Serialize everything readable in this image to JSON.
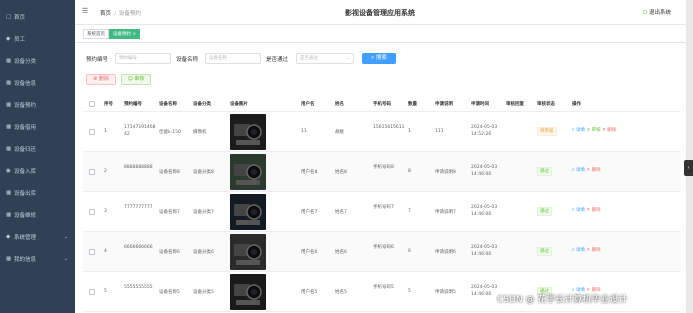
{
  "app": {
    "title": "影视设备管理应用系统",
    "logout": "退出系统"
  },
  "breadcrumb": {
    "home": "首页",
    "sep": "/",
    "current": "设备预约"
  },
  "sidebar": {
    "items": [
      {
        "label": "首页",
        "icon": "□"
      },
      {
        "label": "员工",
        "icon": "◆"
      },
      {
        "label": "设备分类",
        "icon": "▦"
      },
      {
        "label": "设备信息",
        "icon": "▦"
      },
      {
        "label": "设备预约",
        "icon": "▦"
      },
      {
        "label": "设备借用",
        "icon": "▦"
      },
      {
        "label": "设备归还",
        "icon": "▦"
      },
      {
        "label": "设备入库",
        "icon": "◉"
      },
      {
        "label": "设备出库",
        "icon": "▦"
      },
      {
        "label": "设备维修",
        "icon": "▦"
      },
      {
        "label": "系统管理",
        "icon": "◆",
        "arrow": "⌄"
      },
      {
        "label": "我的信息",
        "icon": "▦",
        "arrow": "⌄"
      }
    ]
  },
  "tabs": [
    {
      "label": "系统首页"
    },
    {
      "label": "设备预约 ×"
    }
  ],
  "search": {
    "f1_label": "预约编号",
    "f1_ph": "预约编号",
    "f2_label": "设备名称",
    "f2_ph": "设备名称",
    "f3_label": "是否通过",
    "f3_ph": "是否通过",
    "btn": "搜索"
  },
  "actions": {
    "delete": "删除",
    "audit": "审核"
  },
  "columns": [
    "序号",
    "预约编号",
    "设备名称",
    "设备分类",
    "设备图片",
    "用户名",
    "姓名",
    "手机号码",
    "数量",
    "申请说明",
    "申请时间",
    "审核回复",
    "审核状态",
    "操作"
  ],
  "rows": [
    {
      "no": "1",
      "code": "17147191468 42",
      "name": "佳能k-150",
      "cat": "摄像机",
      "user": "11",
      "realname": "胡桃",
      "phone": "15615615611",
      "qty": "1",
      "desc": "111",
      "time": "2024-05-03 14:52:26",
      "reply": "",
      "status": "待审核",
      "st": "p"
    },
    {
      "no": "2",
      "code": "8888888888",
      "name": "设备名称8",
      "cat": "设备分类8",
      "user": "用户名8",
      "realname": "姓名8",
      "phone": "手机号码8",
      "qty": "8",
      "desc": "申请说明8",
      "time": "2024-05-03 14:46:00",
      "reply": "",
      "status": "通过",
      "st": "g"
    },
    {
      "no": "3",
      "code": "7777777777",
      "name": "设备名称7",
      "cat": "设备分类7",
      "user": "用户名7",
      "realname": "姓名7",
      "phone": "手机号码7",
      "qty": "7",
      "desc": "申请说明7",
      "time": "2024-05-03 14:46:00",
      "reply": "",
      "status": "通过",
      "st": "g"
    },
    {
      "no": "4",
      "code": "6666666666",
      "name": "设备名称6",
      "cat": "设备分类6",
      "user": "用户名6",
      "realname": "姓名6",
      "phone": "手机号码6",
      "qty": "6",
      "desc": "申请说明6",
      "time": "2024-05-03 14:46:00",
      "reply": "",
      "status": "通过",
      "st": "g"
    },
    {
      "no": "5",
      "code": "5555555555",
      "name": "设备名称5",
      "cat": "设备分类5",
      "user": "用户名5",
      "realname": "姓名5",
      "phone": "手机号码5",
      "qty": "5",
      "desc": "申请说明5",
      "time": "2024-05-03 14:46:00",
      "reply": "",
      "status": "通过",
      "st": "g"
    }
  ],
  "ops": {
    "detail": "详情",
    "audit": "审核",
    "delete": "删除"
  },
  "watermark": "CSDN @ 花学长计算机毕业设计"
}
